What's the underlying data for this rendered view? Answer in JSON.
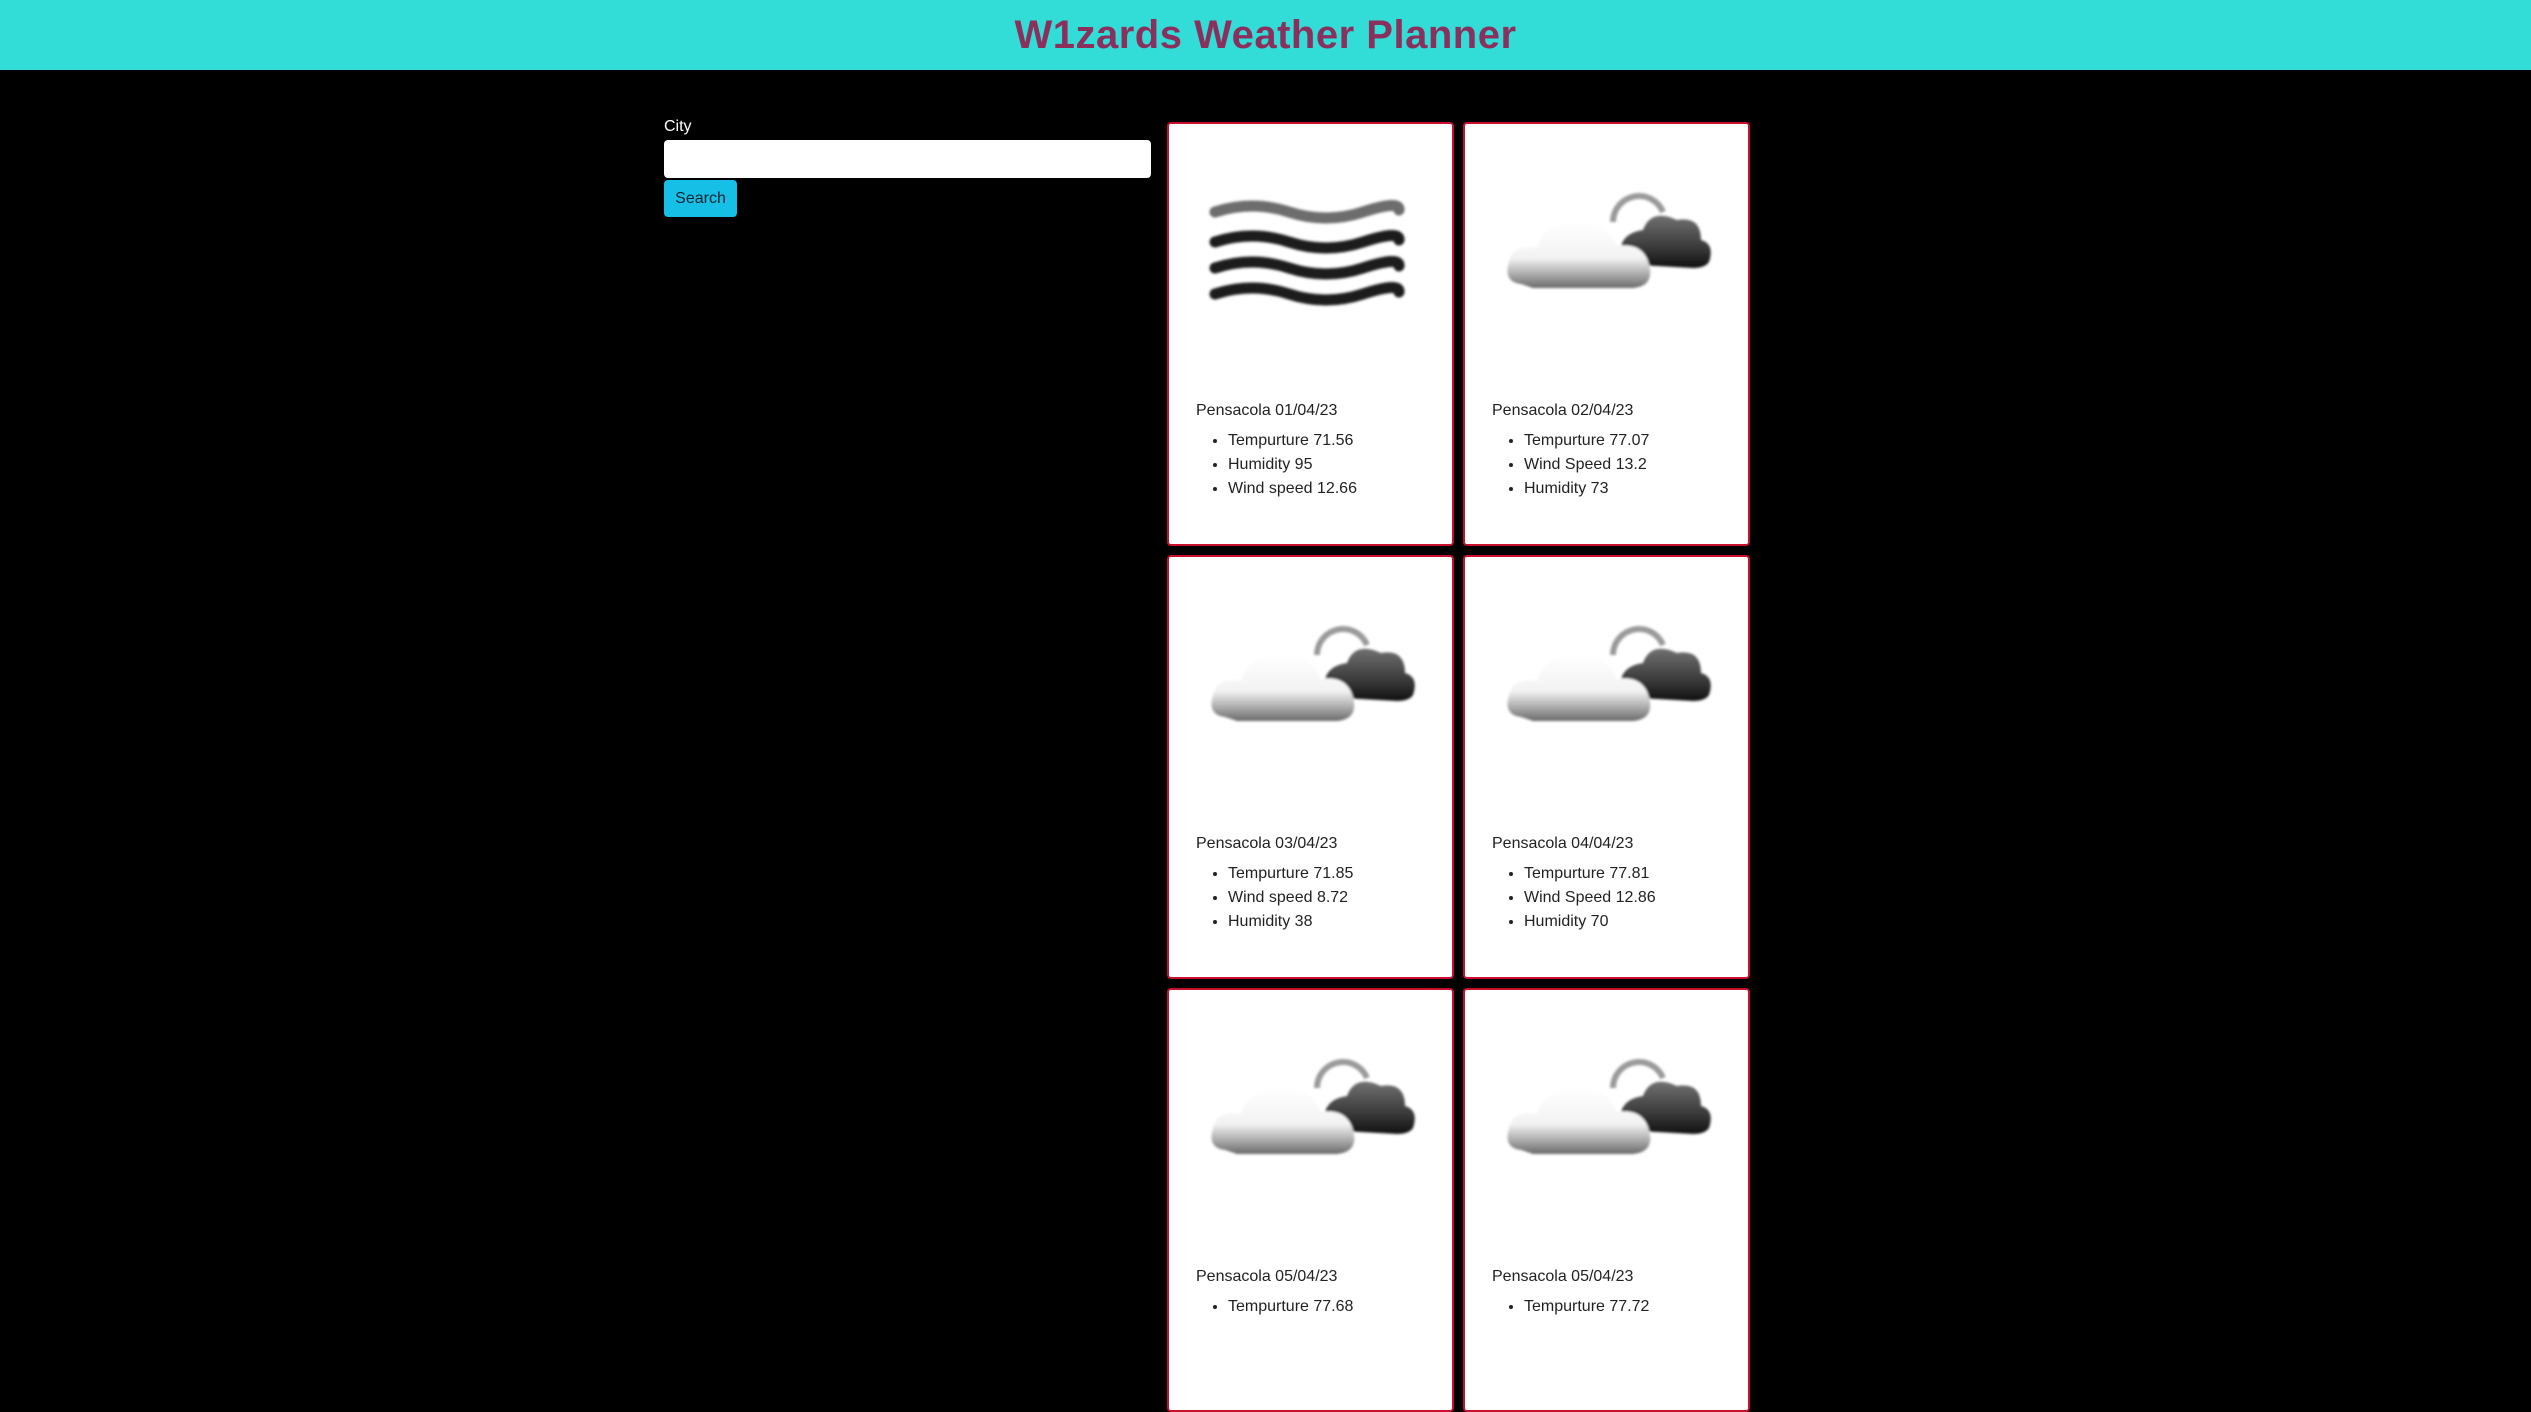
{
  "header": {
    "title": "W1zards Weather Planner",
    "background": "#33ddd7",
    "title_color": "#8b2f5d"
  },
  "search": {
    "label": "City",
    "value": "",
    "button_label": "Search",
    "button_color": "#16bfe6"
  },
  "cards": [
    {
      "title": "Pensacola 01/04/23",
      "icon": "fog-icon",
      "stats": [
        "Tempurture 71.56",
        "Humidity 95",
        "Wind speed 12.66"
      ]
    },
    {
      "title": "Pensacola 02/04/23",
      "icon": "broken-clouds-icon",
      "stats": [
        "Tempurture 77.07",
        "Wind Speed 13.2",
        "Humidity 73"
      ]
    },
    {
      "title": "Pensacola 03/04/23",
      "icon": "broken-clouds-icon",
      "stats": [
        "Tempurture 71.85",
        "Wind speed 8.72",
        "Humidity 38"
      ]
    },
    {
      "title": "Pensacola 04/04/23",
      "icon": "broken-clouds-icon",
      "stats": [
        "Tempurture 77.81",
        "Wind Speed 12.86",
        "Humidity 70"
      ]
    },
    {
      "title": "Pensacola 05/04/23",
      "icon": "broken-clouds-icon",
      "stats": [
        "Tempurture 77.68"
      ]
    },
    {
      "title": "Pensacola 05/04/23",
      "icon": "broken-clouds-icon",
      "stats": [
        "Tempurture 77.72"
      ]
    }
  ]
}
